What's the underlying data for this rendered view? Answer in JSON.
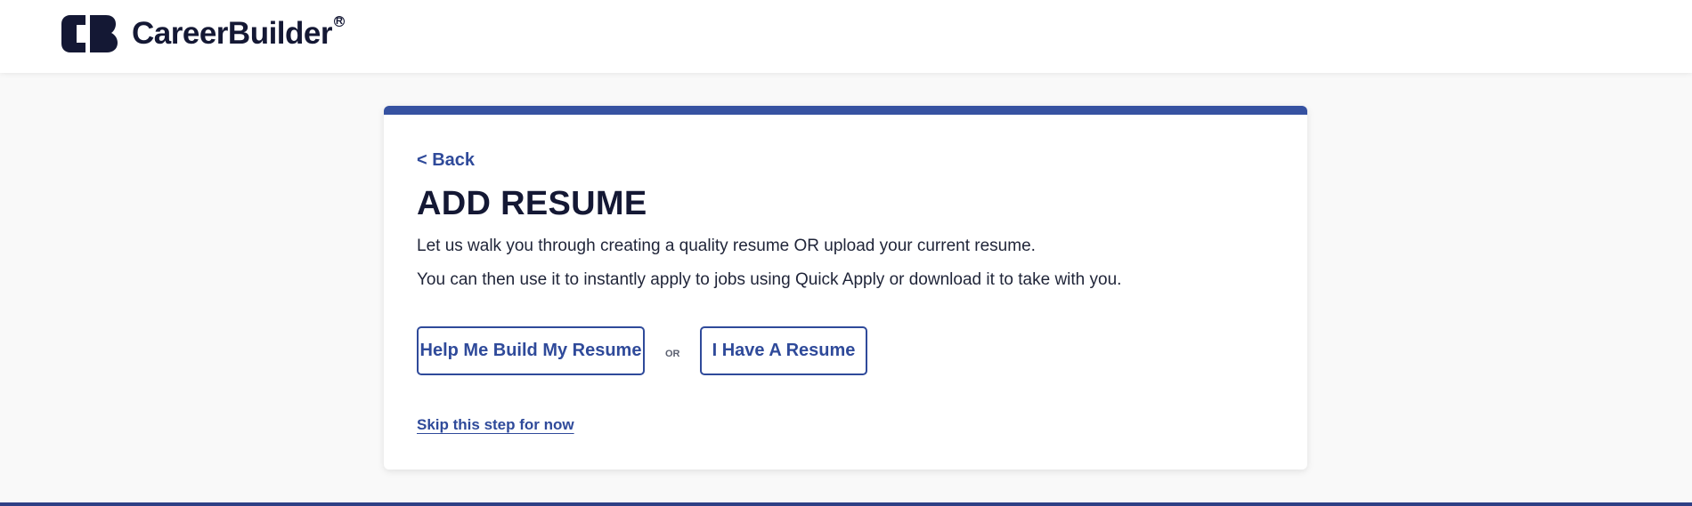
{
  "brand": {
    "logo_icon": "careerbuilder-cb-icon",
    "name": "CareerBuilder",
    "registered_mark": "R",
    "accent_color": "#3652a1"
  },
  "card": {
    "back_label": "< Back",
    "title": "ADD RESUME",
    "description_line1": "Let us walk you through creating a quality resume OR upload your current resume.",
    "description_line2": "You can then use it to instantly apply to jobs using Quick Apply or download it to take with you.",
    "build_button_label": "Help Me Build My Resume",
    "or_label": "OR",
    "have_button_label": "I Have A Resume",
    "skip_label": "Skip this step for now"
  }
}
